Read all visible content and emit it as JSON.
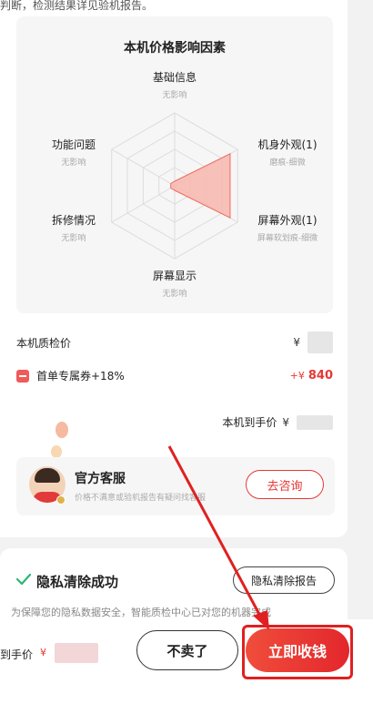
{
  "report": {
    "intro_text": "判断，检测结果详见验机报告。",
    "radar": {
      "title": "本机价格影响因素",
      "axes": [
        {
          "name": "基础信息",
          "status": "无影响",
          "level": 0
        },
        {
          "name": "机身外观(1)",
          "status": "磨痕-细微",
          "level": 0.55
        },
        {
          "name": "屏幕外观(1)",
          "status": "屏幕软划痕-细微",
          "level": 0.55
        },
        {
          "name": "屏幕显示",
          "status": "无影响",
          "level": 0
        },
        {
          "name": "拆修情况",
          "status": "无影响",
          "level": 0
        },
        {
          "name": "功能问题",
          "status": "无影响",
          "level": 0
        }
      ],
      "fill_color": "#f7b7ae",
      "stroke_color": "#ee6b5f"
    }
  },
  "price": {
    "inspect_label": "本机质检价",
    "yen": "¥",
    "coupon_label": "首单专属券+18%",
    "coupon_prefix": "+¥",
    "coupon_amount": "840",
    "receive_label": "本机到手价"
  },
  "service": {
    "title": "官方客服",
    "subtitle": "价格不满意或验机报告有疑问找客服",
    "button": "去咨询"
  },
  "privacy": {
    "title": "隐私清除成功",
    "report_button": "隐私清除报告",
    "description": "为保障您的隐私数据安全，智能质检中心已对您的机器完成"
  },
  "bottom": {
    "total_label": "到手价",
    "yen": "¥",
    "no_sell_button": "不卖了",
    "collect_button": "立即收钱"
  },
  "colors": {
    "accent_red": "#e53935",
    "annotation_red": "#e02020"
  }
}
